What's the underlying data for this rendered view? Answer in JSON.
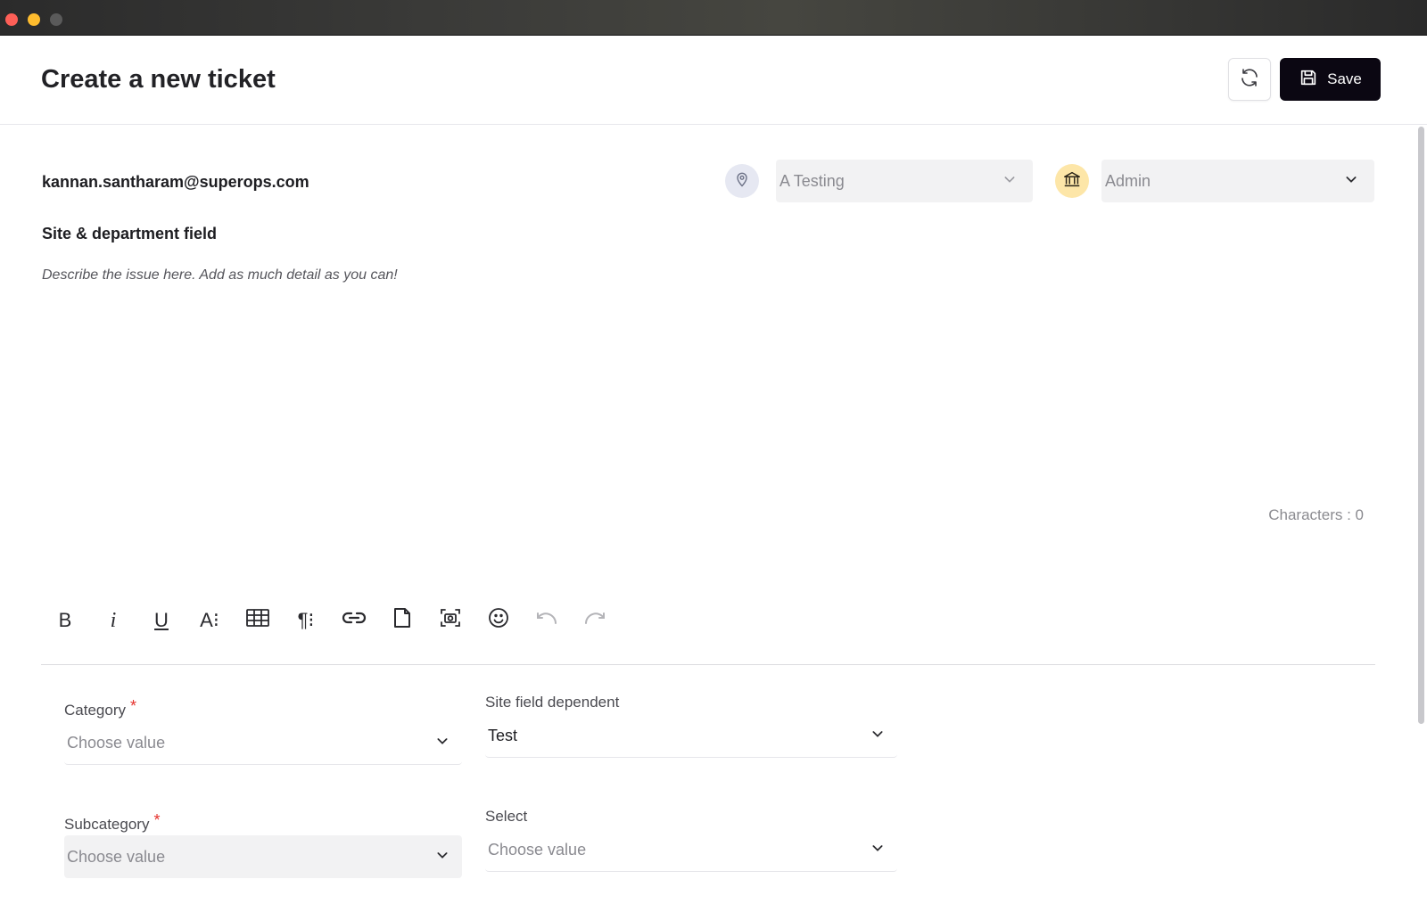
{
  "header": {
    "title": "Create a new ticket",
    "save_label": "Save"
  },
  "ticket": {
    "requester": "kannan.santharam@superops.com",
    "site_value": "A Testing",
    "department_value": "Admin",
    "subject": "Site & department field",
    "description_placeholder": "Describe the issue here. Add as much detail as you can!",
    "characters_label": "Characters : 0"
  },
  "toolbar": {
    "bold": "B",
    "italic": "i",
    "underline": "U",
    "font": "A⁝",
    "paragraph": "¶⁝"
  },
  "fields": {
    "category": {
      "label": "Category",
      "required_mark": "*",
      "placeholder": "Choose value"
    },
    "site_field_dependent": {
      "label": "Site field dependent",
      "value": "Test"
    },
    "subcategory": {
      "label": "Subcategory",
      "required_mark": "*",
      "placeholder": "Choose value"
    },
    "select": {
      "label": "Select",
      "placeholder": "Choose value"
    }
  },
  "colors": {
    "primary_button": "#0b0712",
    "required": "#e5322d",
    "site_icon_bg": "#e6e8f2",
    "department_icon_bg": "#fde6a8"
  }
}
